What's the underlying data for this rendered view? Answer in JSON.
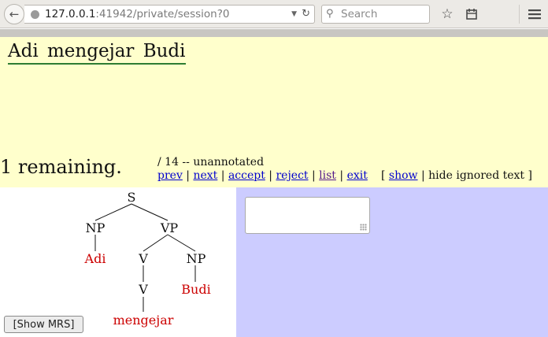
{
  "browser": {
    "url_host": "127.0.0.1",
    "url_rest": ":41942/private/session?0",
    "search_placeholder": "Search"
  },
  "page": {
    "sentence": "Adi mengejar Budi",
    "remaining": "1 remaining.",
    "status": "/ 14 -- unannotated",
    "nav": {
      "prev": "prev",
      "next": "next",
      "accept": "accept",
      "reject": "reject",
      "list": "list",
      "exit": "exit",
      "separator": " | "
    },
    "ignored_text": {
      "open": "[ ",
      "show": "show",
      "hide": " | hide ignored text ]"
    },
    "show_mrs_label": "[Show MRS]"
  },
  "tree": {
    "nodes": {
      "s": "S",
      "np1": "NP",
      "vp": "VP",
      "adi": "Adi",
      "v1": "V",
      "np2": "NP",
      "v2": "V",
      "budi": "Budi",
      "mengejar": "mengejar"
    },
    "colors": {
      "nonterminal": "#111111",
      "terminal": "#cc0000"
    }
  },
  "colors": {
    "header_bg": "#ffffcc",
    "panel_bg": "#ccccff",
    "underline": "#2e7d32"
  },
  "icons": [
    "back-arrow-icon",
    "globe-icon",
    "dropdown-icon",
    "reload-icon",
    "search-icon",
    "bookmark-star-icon",
    "reading-list-icon",
    "menu-icon"
  ]
}
